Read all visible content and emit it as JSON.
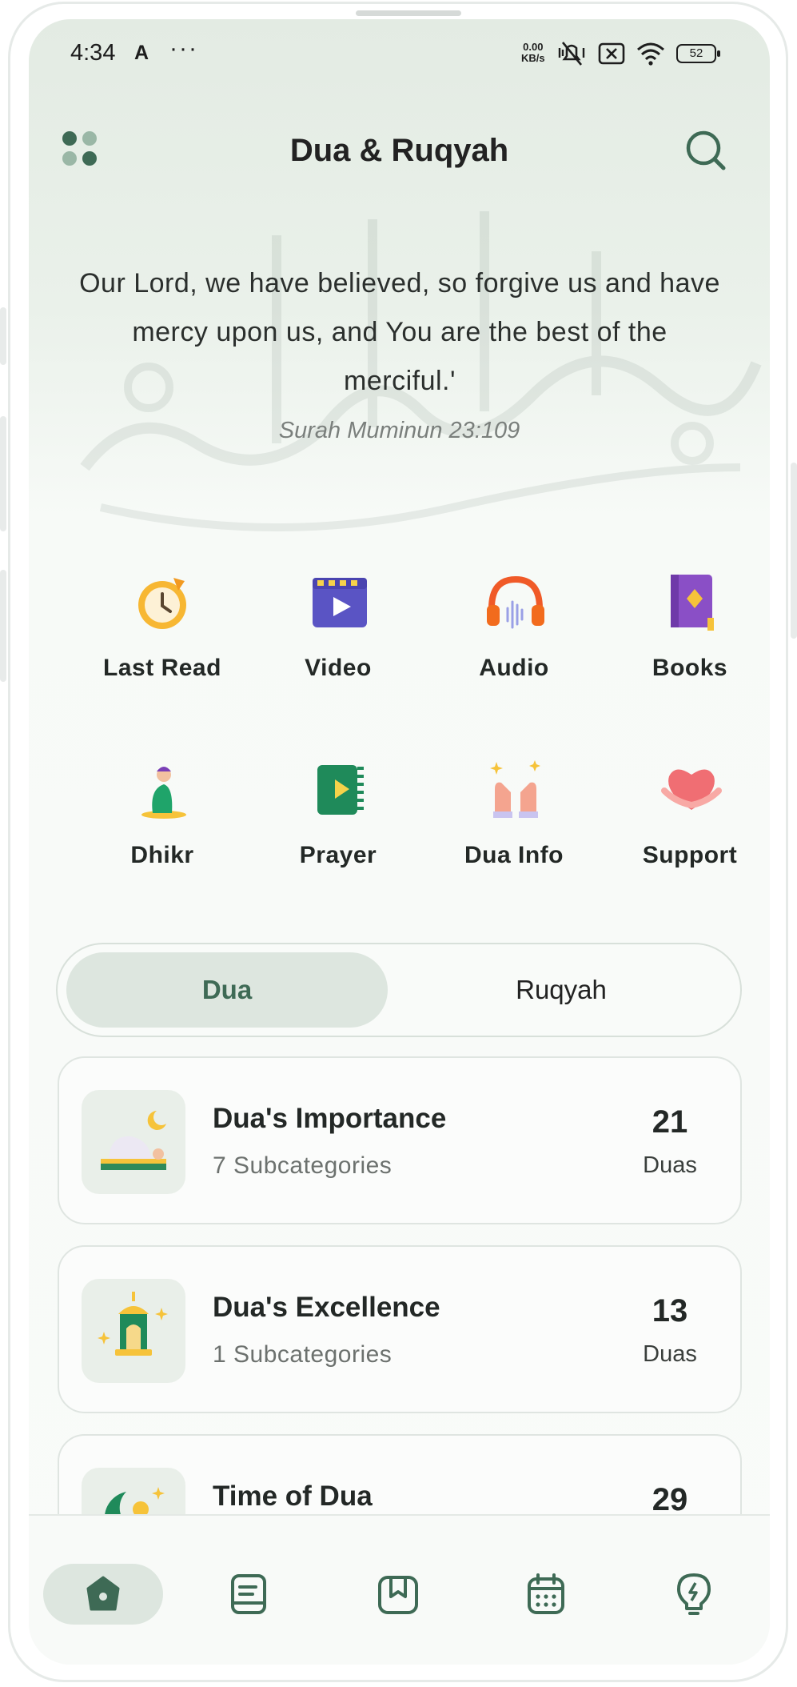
{
  "status_bar": {
    "time": "4:34",
    "net_speed_value": "0.00",
    "net_speed_unit": "KB/s",
    "battery": "52"
  },
  "header": {
    "title": "Dua & Ruqyah"
  },
  "hero": {
    "quote": "Our Lord, we have believed, so forgive us and have mercy upon us, and You are the best of the merciful.'",
    "reference": "Surah Muminun 23:109"
  },
  "features": [
    {
      "label": "Last Read",
      "icon": "clock-refresh-icon"
    },
    {
      "label": "Video",
      "icon": "video-icon"
    },
    {
      "label": "Audio",
      "icon": "headphones-icon"
    },
    {
      "label": "Books",
      "icon": "book-icon"
    },
    {
      "label": "Dhikr",
      "icon": "praying-person-icon"
    },
    {
      "label": "Prayer",
      "icon": "prayer-book-icon"
    },
    {
      "label": "Dua Info",
      "icon": "raised-hands-icon"
    },
    {
      "label": "Support",
      "icon": "heart-hands-icon"
    }
  ],
  "tabs": {
    "active": "Dua",
    "inactive": "Ruqyah"
  },
  "categories": [
    {
      "title": "Dua's Importance",
      "subtitle": "7 Subcategories",
      "count": "21",
      "unit": "Duas",
      "icon": "prostrating-person-icon"
    },
    {
      "title": "Dua's Excellence",
      "subtitle": "1 Subcategories",
      "count": "13",
      "unit": "Duas",
      "icon": "lantern-icon"
    },
    {
      "title": "Time of Dua",
      "subtitle": "",
      "count": "29",
      "unit": "",
      "icon": "crescent-moon-icon"
    }
  ],
  "bottom_nav": [
    {
      "name": "home",
      "icon": "home-icon",
      "active": true
    },
    {
      "name": "notes",
      "icon": "notes-icon",
      "active": false
    },
    {
      "name": "bookmarks",
      "icon": "bookmark-book-icon",
      "active": false
    },
    {
      "name": "calendar",
      "icon": "calendar-icon",
      "active": false
    },
    {
      "name": "ideas",
      "icon": "lightbulb-icon",
      "active": false
    }
  ],
  "colors": {
    "accent": "#3e6a55",
    "tab_active_bg": "#dde6df",
    "background": "#f9fbf9"
  }
}
